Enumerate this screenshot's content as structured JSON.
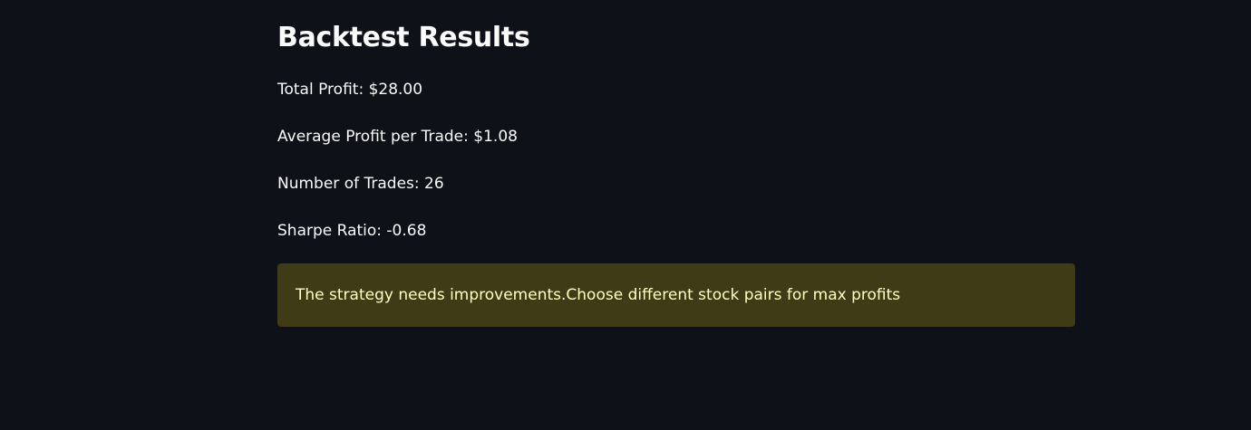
{
  "header": {
    "title": "Backtest Results"
  },
  "results": {
    "total_profit": "Total Profit: $28.00",
    "average_profit": "Average Profit per Trade: $1.08",
    "number_of_trades": "Number of Trades: 26",
    "sharpe_ratio": "Sharpe Ratio: -0.68"
  },
  "alert": {
    "type": "warning",
    "message": "The strategy needs improvements.Choose different stock pairs for max profits",
    "background_color": "#3e3b16",
    "text_color": "#ffffc2"
  },
  "theme": {
    "background": "#0e1117",
    "text": "#fafafa"
  }
}
